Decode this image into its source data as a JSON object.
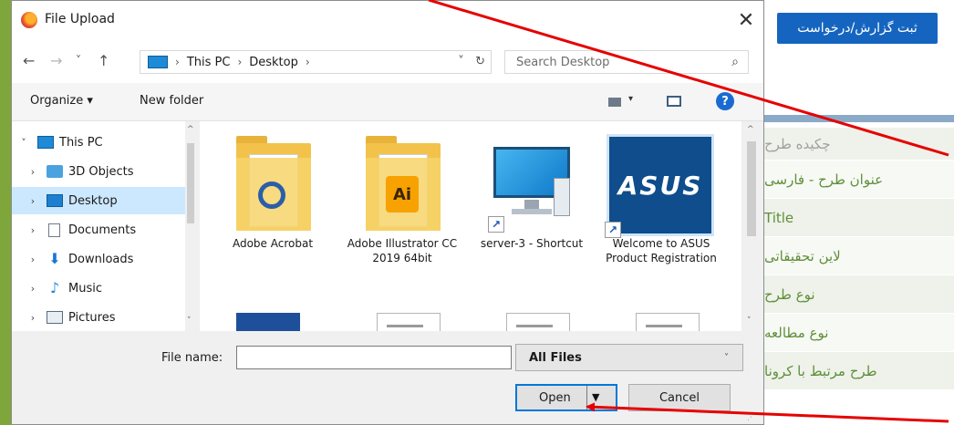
{
  "page": {
    "submit_button": "ثبت گزارش/درخواست",
    "rows": [
      "چکیده طرح",
      "عنوان طرح - فارسی",
      "Title",
      "لاین تحقیقاتی",
      "نوع طرح",
      "نوع مطالعه",
      "طرح مرتبط با کرونا"
    ]
  },
  "dialog": {
    "title": "File Upload",
    "close_glyph": "✕",
    "nav": {
      "back": "←",
      "forward": "→",
      "recent": "˅",
      "up": "↑"
    },
    "address": {
      "crumbs": [
        "This PC",
        "Desktop"
      ],
      "separator": "›",
      "dropdown": "˅",
      "refresh": "↻"
    },
    "search": {
      "placeholder": "Search Desktop",
      "icon": "⌕"
    },
    "toolbar": {
      "organize": "Organize ▾",
      "new_folder": "New folder",
      "view_caret": "▾",
      "help": "?"
    },
    "tree": [
      {
        "label": "This PC",
        "chevron": "˅"
      },
      {
        "label": "3D Objects",
        "chevron": "›"
      },
      {
        "label": "Desktop",
        "chevron": "›",
        "selected": true
      },
      {
        "label": "Documents",
        "chevron": "›"
      },
      {
        "label": "Downloads",
        "chevron": "›"
      },
      {
        "label": "Music",
        "chevron": "›"
      },
      {
        "label": "Pictures",
        "chevron": "›"
      }
    ],
    "tree_glyphs": {
      "download": "⬇",
      "music": "♪"
    },
    "files": [
      {
        "label": "Adobe Acrobat"
      },
      {
        "label": "Adobe Illustrator CC 2019 64bit",
        "mark": "Ai"
      },
      {
        "label": "server-3 - Shortcut"
      },
      {
        "label": "Welcome to ASUS Product Registration",
        "logo": "ASUS"
      }
    ],
    "scroll_glyphs": {
      "up": "^",
      "down": "˅"
    },
    "shortcut_glyph": "↗",
    "filename": {
      "label": "File name:",
      "value": "",
      "caret": "˅"
    },
    "filetype": {
      "value": "All Files",
      "caret": "˅"
    },
    "buttons": {
      "open": "Open",
      "open_caret": "▼",
      "cancel": "Cancel"
    },
    "grip": "⋰"
  },
  "colors": {
    "accent": "#0078d7",
    "annotation": "#e60000",
    "page_green": "#5f8f3a",
    "submit_blue": "#1565c0"
  }
}
